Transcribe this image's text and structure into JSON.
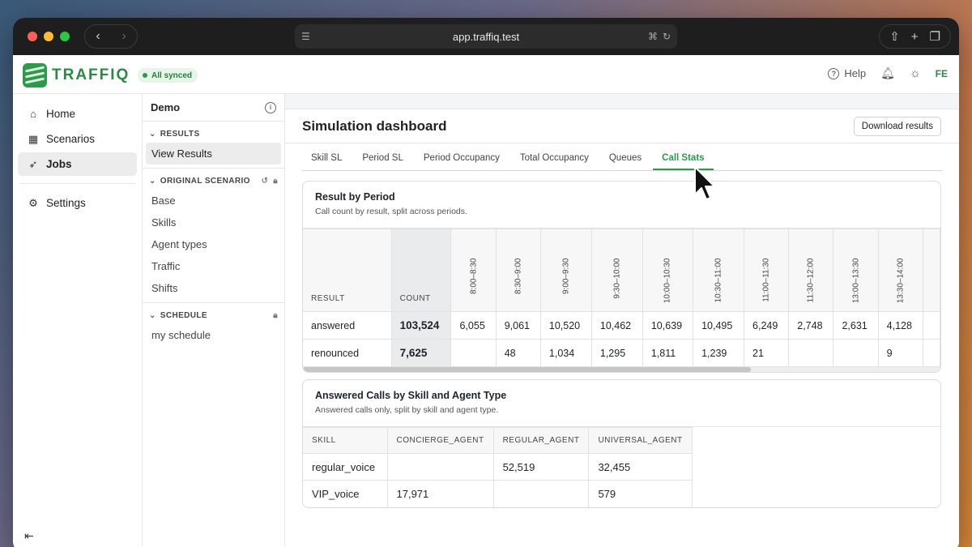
{
  "browser": {
    "url": "app.traffiq.test"
  },
  "app": {
    "logo_text": "TRAFFIQ",
    "sync_status": "All synced",
    "help_label": "Help",
    "user_initials": "FE",
    "accent_color": "#2a9a4a"
  },
  "sidebar": {
    "items": [
      {
        "label": "Home",
        "icon": "home-icon"
      },
      {
        "label": "Scenarios",
        "icon": "scenarios-icon"
      },
      {
        "label": "Jobs",
        "icon": "rocket-icon",
        "active": true
      }
    ],
    "settings_label": "Settings"
  },
  "panel": {
    "title": "Demo",
    "results_header": "RESULTS",
    "view_results": "View Results",
    "original_header": "ORIGINAL SCENARIO",
    "original_items": [
      "Base",
      "Skills",
      "Agent types",
      "Traffic",
      "Shifts"
    ],
    "schedule_header": "SCHEDULE",
    "schedule_items": [
      "my schedule"
    ]
  },
  "main": {
    "title": "Simulation dashboard",
    "download_label": "Download results",
    "tabs": [
      "Skill SL",
      "Period SL",
      "Period Occupancy",
      "Total Occupancy",
      "Queues",
      "Call Stats"
    ],
    "active_tab": "Call Stats"
  },
  "result_by_period": {
    "title": "Result by Period",
    "subtitle": "Call count by result, split across periods.",
    "col_result": "RESULT",
    "col_count": "COUNT",
    "periods": [
      "8:00–8:30",
      "8:30–9:00",
      "9:00–9:30",
      "9:30–10:00",
      "10:00–10:30",
      "10:30–11:00",
      "11:00–11:30",
      "11:30–12:00",
      "13:00–13:30",
      "13:30–14:00"
    ],
    "rows": [
      {
        "result": "answered",
        "count": "103,524",
        "values": [
          "6,055",
          "9,061",
          "10,520",
          "10,462",
          "10,639",
          "10,495",
          "6,249",
          "2,748",
          "2,631",
          "4,128"
        ]
      },
      {
        "result": "renounced",
        "count": "7,625",
        "values": [
          "",
          "48",
          "1,034",
          "1,295",
          "1,811",
          "1,239",
          "21",
          "",
          "",
          "9"
        ]
      }
    ]
  },
  "answered_by_skill": {
    "title": "Answered Calls by Skill and Agent Type",
    "subtitle": "Answered calls only, split by skill and agent type.",
    "columns": [
      "SKILL",
      "CONCIERGE_AGENT",
      "REGULAR_AGENT",
      "UNIVERSAL_AGENT"
    ],
    "rows": [
      [
        "regular_voice",
        "",
        "52,519",
        "32,455"
      ],
      [
        "VIP_voice",
        "17,971",
        "",
        "579"
      ]
    ]
  }
}
